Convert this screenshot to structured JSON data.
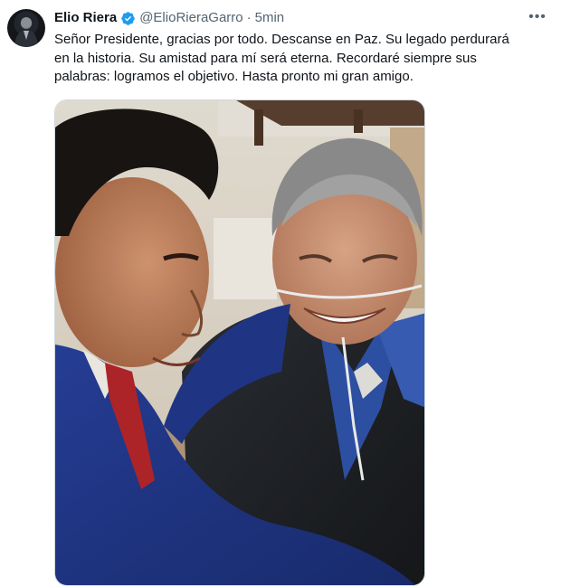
{
  "tweet": {
    "author": {
      "name": "Elio Riera",
      "handle": "@ElioRieraGarro",
      "verified": true,
      "avatar_icon": "profile-photo"
    },
    "separator": "·",
    "time": "5min",
    "more_icon": "more-horizontal-icon",
    "more_label": "•••",
    "text_lines": [
      "Señor Presidente, gracias por todo. Descanse en Paz. Su legado perdurará",
      "en la historia. Su amistad para mí será eterna. Recordaré siempre sus",
      "palabras: logramos el objetivo. Hasta pronto mi gran amigo."
    ],
    "media": {
      "type": "photo",
      "description_icon": "photo-two-men-smiling"
    }
  },
  "colors": {
    "text": "#0f1419",
    "secondary": "#536471",
    "verified": "#1d9bf0",
    "border": "#cfd9de"
  }
}
